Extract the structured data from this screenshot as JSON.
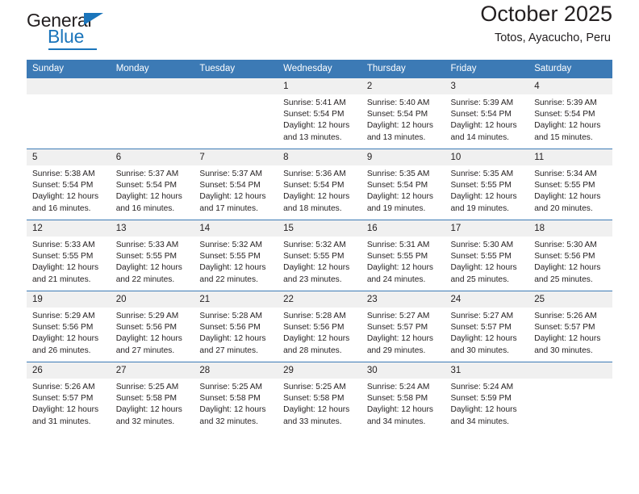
{
  "brand": {
    "name_top": "General",
    "name_bottom": "Blue",
    "triangle_icon": "triangle-logo-mark",
    "color_primary": "#1b75bb",
    "color_text": "#231f20"
  },
  "header": {
    "title": "October 2025",
    "subtitle": "Totos, Ayacucho, Peru"
  },
  "calendar": {
    "header_color": "#3c7ab5",
    "daynum_band_color": "#f0f0f0",
    "weekday_headers": [
      "Sunday",
      "Monday",
      "Tuesday",
      "Wednesday",
      "Thursday",
      "Friday",
      "Saturday"
    ],
    "weeks": [
      [
        {
          "day": "",
          "sunrise": "",
          "sunset": "",
          "daylight_line1": "",
          "daylight_line2": ""
        },
        {
          "day": "",
          "sunrise": "",
          "sunset": "",
          "daylight_line1": "",
          "daylight_line2": ""
        },
        {
          "day": "",
          "sunrise": "",
          "sunset": "",
          "daylight_line1": "",
          "daylight_line2": ""
        },
        {
          "day": "1",
          "sunrise": "Sunrise: 5:41 AM",
          "sunset": "Sunset: 5:54 PM",
          "daylight_line1": "Daylight: 12 hours",
          "daylight_line2": "and 13 minutes."
        },
        {
          "day": "2",
          "sunrise": "Sunrise: 5:40 AM",
          "sunset": "Sunset: 5:54 PM",
          "daylight_line1": "Daylight: 12 hours",
          "daylight_line2": "and 13 minutes."
        },
        {
          "day": "3",
          "sunrise": "Sunrise: 5:39 AM",
          "sunset": "Sunset: 5:54 PM",
          "daylight_line1": "Daylight: 12 hours",
          "daylight_line2": "and 14 minutes."
        },
        {
          "day": "4",
          "sunrise": "Sunrise: 5:39 AM",
          "sunset": "Sunset: 5:54 PM",
          "daylight_line1": "Daylight: 12 hours",
          "daylight_line2": "and 15 minutes."
        }
      ],
      [
        {
          "day": "5",
          "sunrise": "Sunrise: 5:38 AM",
          "sunset": "Sunset: 5:54 PM",
          "daylight_line1": "Daylight: 12 hours",
          "daylight_line2": "and 16 minutes."
        },
        {
          "day": "6",
          "sunrise": "Sunrise: 5:37 AM",
          "sunset": "Sunset: 5:54 PM",
          "daylight_line1": "Daylight: 12 hours",
          "daylight_line2": "and 16 minutes."
        },
        {
          "day": "7",
          "sunrise": "Sunrise: 5:37 AM",
          "sunset": "Sunset: 5:54 PM",
          "daylight_line1": "Daylight: 12 hours",
          "daylight_line2": "and 17 minutes."
        },
        {
          "day": "8",
          "sunrise": "Sunrise: 5:36 AM",
          "sunset": "Sunset: 5:54 PM",
          "daylight_line1": "Daylight: 12 hours",
          "daylight_line2": "and 18 minutes."
        },
        {
          "day": "9",
          "sunrise": "Sunrise: 5:35 AM",
          "sunset": "Sunset: 5:54 PM",
          "daylight_line1": "Daylight: 12 hours",
          "daylight_line2": "and 19 minutes."
        },
        {
          "day": "10",
          "sunrise": "Sunrise: 5:35 AM",
          "sunset": "Sunset: 5:55 PM",
          "daylight_line1": "Daylight: 12 hours",
          "daylight_line2": "and 19 minutes."
        },
        {
          "day": "11",
          "sunrise": "Sunrise: 5:34 AM",
          "sunset": "Sunset: 5:55 PM",
          "daylight_line1": "Daylight: 12 hours",
          "daylight_line2": "and 20 minutes."
        }
      ],
      [
        {
          "day": "12",
          "sunrise": "Sunrise: 5:33 AM",
          "sunset": "Sunset: 5:55 PM",
          "daylight_line1": "Daylight: 12 hours",
          "daylight_line2": "and 21 minutes."
        },
        {
          "day": "13",
          "sunrise": "Sunrise: 5:33 AM",
          "sunset": "Sunset: 5:55 PM",
          "daylight_line1": "Daylight: 12 hours",
          "daylight_line2": "and 22 minutes."
        },
        {
          "day": "14",
          "sunrise": "Sunrise: 5:32 AM",
          "sunset": "Sunset: 5:55 PM",
          "daylight_line1": "Daylight: 12 hours",
          "daylight_line2": "and 22 minutes."
        },
        {
          "day": "15",
          "sunrise": "Sunrise: 5:32 AM",
          "sunset": "Sunset: 5:55 PM",
          "daylight_line1": "Daylight: 12 hours",
          "daylight_line2": "and 23 minutes."
        },
        {
          "day": "16",
          "sunrise": "Sunrise: 5:31 AM",
          "sunset": "Sunset: 5:55 PM",
          "daylight_line1": "Daylight: 12 hours",
          "daylight_line2": "and 24 minutes."
        },
        {
          "day": "17",
          "sunrise": "Sunrise: 5:30 AM",
          "sunset": "Sunset: 5:55 PM",
          "daylight_line1": "Daylight: 12 hours",
          "daylight_line2": "and 25 minutes."
        },
        {
          "day": "18",
          "sunrise": "Sunrise: 5:30 AM",
          "sunset": "Sunset: 5:56 PM",
          "daylight_line1": "Daylight: 12 hours",
          "daylight_line2": "and 25 minutes."
        }
      ],
      [
        {
          "day": "19",
          "sunrise": "Sunrise: 5:29 AM",
          "sunset": "Sunset: 5:56 PM",
          "daylight_line1": "Daylight: 12 hours",
          "daylight_line2": "and 26 minutes."
        },
        {
          "day": "20",
          "sunrise": "Sunrise: 5:29 AM",
          "sunset": "Sunset: 5:56 PM",
          "daylight_line1": "Daylight: 12 hours",
          "daylight_line2": "and 27 minutes."
        },
        {
          "day": "21",
          "sunrise": "Sunrise: 5:28 AM",
          "sunset": "Sunset: 5:56 PM",
          "daylight_line1": "Daylight: 12 hours",
          "daylight_line2": "and 27 minutes."
        },
        {
          "day": "22",
          "sunrise": "Sunrise: 5:28 AM",
          "sunset": "Sunset: 5:56 PM",
          "daylight_line1": "Daylight: 12 hours",
          "daylight_line2": "and 28 minutes."
        },
        {
          "day": "23",
          "sunrise": "Sunrise: 5:27 AM",
          "sunset": "Sunset: 5:57 PM",
          "daylight_line1": "Daylight: 12 hours",
          "daylight_line2": "and 29 minutes."
        },
        {
          "day": "24",
          "sunrise": "Sunrise: 5:27 AM",
          "sunset": "Sunset: 5:57 PM",
          "daylight_line1": "Daylight: 12 hours",
          "daylight_line2": "and 30 minutes."
        },
        {
          "day": "25",
          "sunrise": "Sunrise: 5:26 AM",
          "sunset": "Sunset: 5:57 PM",
          "daylight_line1": "Daylight: 12 hours",
          "daylight_line2": "and 30 minutes."
        }
      ],
      [
        {
          "day": "26",
          "sunrise": "Sunrise: 5:26 AM",
          "sunset": "Sunset: 5:57 PM",
          "daylight_line1": "Daylight: 12 hours",
          "daylight_line2": "and 31 minutes."
        },
        {
          "day": "27",
          "sunrise": "Sunrise: 5:25 AM",
          "sunset": "Sunset: 5:58 PM",
          "daylight_line1": "Daylight: 12 hours",
          "daylight_line2": "and 32 minutes."
        },
        {
          "day": "28",
          "sunrise": "Sunrise: 5:25 AM",
          "sunset": "Sunset: 5:58 PM",
          "daylight_line1": "Daylight: 12 hours",
          "daylight_line2": "and 32 minutes."
        },
        {
          "day": "29",
          "sunrise": "Sunrise: 5:25 AM",
          "sunset": "Sunset: 5:58 PM",
          "daylight_line1": "Daylight: 12 hours",
          "daylight_line2": "and 33 minutes."
        },
        {
          "day": "30",
          "sunrise": "Sunrise: 5:24 AM",
          "sunset": "Sunset: 5:58 PM",
          "daylight_line1": "Daylight: 12 hours",
          "daylight_line2": "and 34 minutes."
        },
        {
          "day": "31",
          "sunrise": "Sunrise: 5:24 AM",
          "sunset": "Sunset: 5:59 PM",
          "daylight_line1": "Daylight: 12 hours",
          "daylight_line2": "and 34 minutes."
        },
        {
          "day": "",
          "sunrise": "",
          "sunset": "",
          "daylight_line1": "",
          "daylight_line2": ""
        }
      ]
    ]
  }
}
